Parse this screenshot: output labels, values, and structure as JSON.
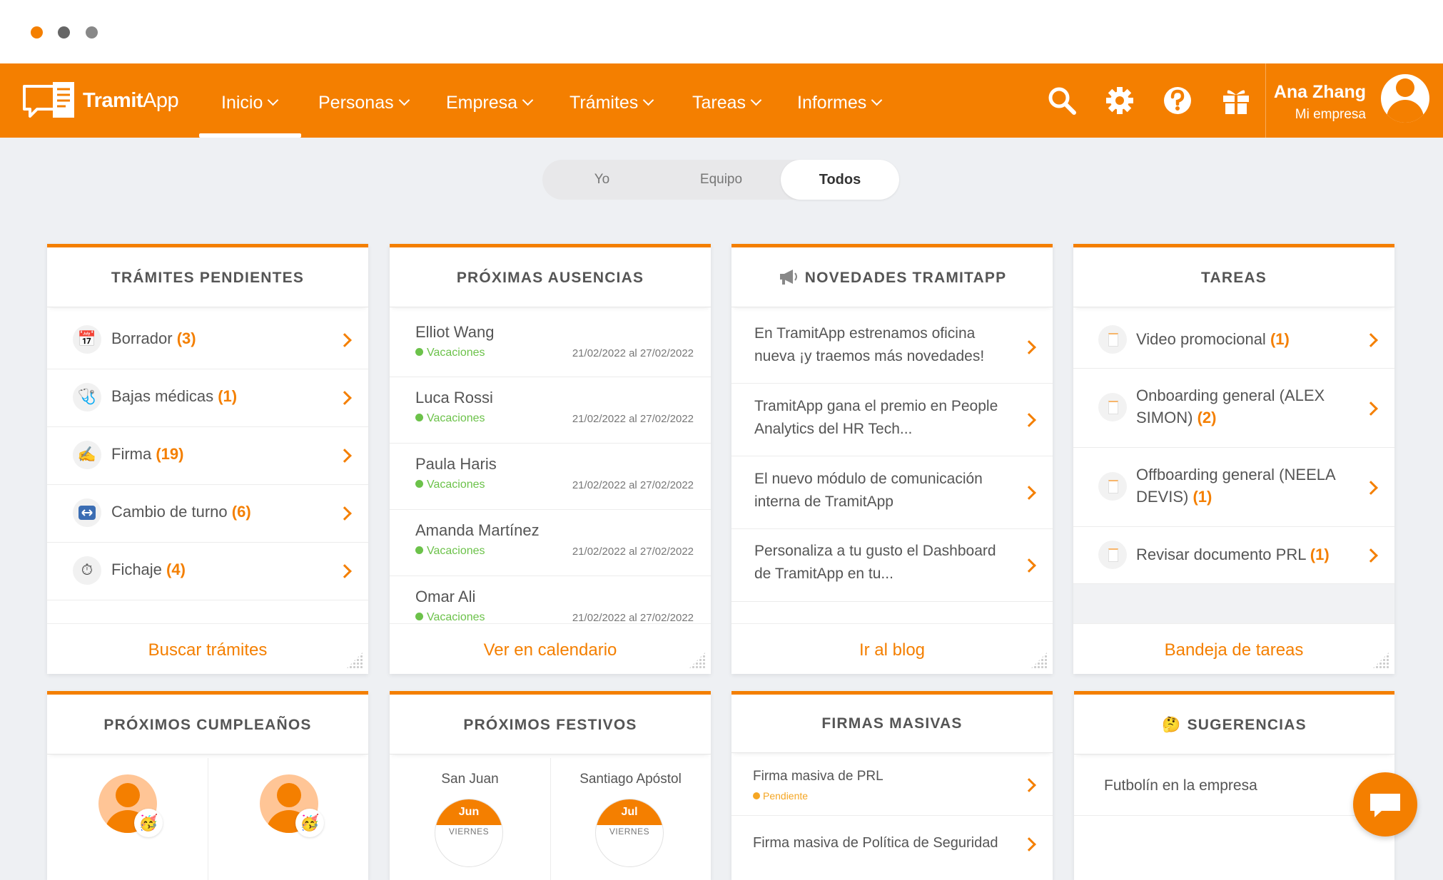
{
  "brand": {
    "name_part1": "Tramit",
    "name_part2": "App"
  },
  "nav": {
    "items": [
      {
        "label": "Inicio"
      },
      {
        "label": "Personas"
      },
      {
        "label": "Empresa"
      },
      {
        "label": "Trámites"
      },
      {
        "label": "Tareas"
      },
      {
        "label": "Informes"
      }
    ],
    "active": "Inicio"
  },
  "user": {
    "name": "Ana Zhang",
    "company": "Mi empresa"
  },
  "scope_tabs": {
    "items": [
      "Yo",
      "Equipo",
      "Todos"
    ],
    "active": "Todos"
  },
  "tramites": {
    "title": "TRÁMITES PENDIENTES",
    "items": [
      {
        "label": "Borrador",
        "count": "(3)",
        "icon": "calendar-icon"
      },
      {
        "label": "Bajas médicas",
        "count": "(1)",
        "icon": "stethoscope-icon"
      },
      {
        "label": "Firma",
        "count": "(19)",
        "icon": "signature-icon"
      },
      {
        "label": "Cambio de turno",
        "count": "(6)",
        "icon": "swap-icon"
      },
      {
        "label": "Fichaje",
        "count": "(4)",
        "icon": "stopwatch-icon"
      }
    ],
    "footer": "Buscar trámites"
  },
  "ausencias": {
    "title": "PRÓXIMAS AUSENCIAS",
    "items": [
      {
        "name": "Elliot Wang",
        "type": "Vacaciones",
        "dates": "21/02/2022 al 27/02/2022"
      },
      {
        "name": "Luca Rossi",
        "type": "Vacaciones",
        "dates": "21/02/2022 al 27/02/2022"
      },
      {
        "name": "Paula Haris",
        "type": "Vacaciones",
        "dates": "21/02/2022 al 27/02/2022"
      },
      {
        "name": "Amanda Martínez",
        "type": "Vacaciones",
        "dates": "21/02/2022 al 27/02/2022"
      },
      {
        "name": "Omar Ali",
        "type": "Vacaciones",
        "dates": "21/02/2022 al 27/02/2022"
      }
    ],
    "footer": "Ver en calendario"
  },
  "novedades": {
    "title": "NOVEDADES TRAMITAPP",
    "items": [
      "En TramitApp estrenamos oficina nueva ¡y traemos más novedades!",
      "TramitApp gana el premio en People Analytics del HR Tech...",
      "El nuevo módulo de comunicación interna de TramitApp",
      "Personaliza a tu gusto el Dashboard de TramitApp en tu..."
    ],
    "footer": "Ir al blog"
  },
  "tareas": {
    "title": "TAREAS",
    "items": [
      {
        "label": "Video promocional",
        "count": "(1)"
      },
      {
        "label": "Onboarding general (ALEX SIMON)",
        "count": "(2)"
      },
      {
        "label": "Offboarding general (NEELA DEVIS)",
        "count": "(1)"
      },
      {
        "label": "Revisar documento PRL",
        "count": "(1)"
      }
    ],
    "footer": "Bandeja de tareas"
  },
  "cumpleanos": {
    "title": "PRÓXIMOS CUMPLEAÑOS"
  },
  "festivos": {
    "title": "PRÓXIMOS FESTIVOS",
    "items": [
      {
        "name": "San Juan",
        "month": "Jun",
        "weekday": "VIERNES"
      },
      {
        "name": "Santiago Apóstol",
        "month": "Jul",
        "weekday": "VIERNES"
      }
    ]
  },
  "firmas": {
    "title": "FIRMAS MASIVAS",
    "items": [
      {
        "title": "Firma masiva de PRL",
        "status": "Pendiente"
      },
      {
        "title": "Firma masiva de Política de Seguridad",
        "status": ""
      }
    ]
  },
  "sugerencias": {
    "title": "SUGERENCIAS",
    "items": [
      "Futbolín en la empresa"
    ]
  },
  "colors": {
    "brand": "#f47f00",
    "success": "#6cc24a",
    "pending": "#f5a623"
  }
}
